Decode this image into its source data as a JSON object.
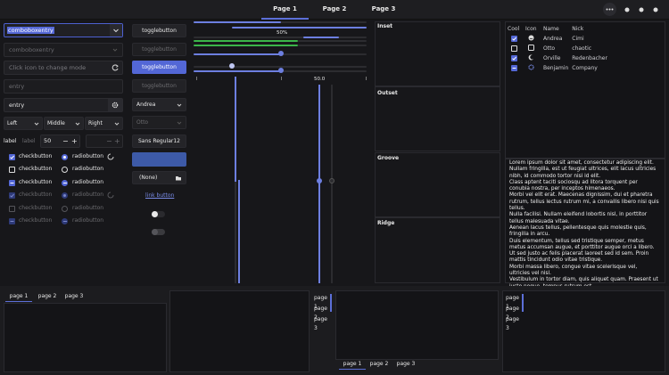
{
  "header": {
    "tabs": [
      "Page 1",
      "Page 2",
      "Page 3"
    ],
    "active_tab": 0
  },
  "left_column": {
    "combo_entry": "comboboxentry",
    "combo_entry_dim": "comboboxentry",
    "icon_entry_placeholder": "Click icon to change mode",
    "entry_placeholder": "entry",
    "entry_value": "entry",
    "align_buttons": [
      "Left",
      "Middle",
      "Right"
    ],
    "spin_label": "label",
    "spin_label_dim": "label",
    "spin_value": "50",
    "spin_minus": "−",
    "spin_plus": "+",
    "checks": [
      {
        "label": "checkbutton",
        "state": "checked",
        "dim": false
      },
      {
        "label": "checkbutton",
        "state": "unchecked",
        "dim": false
      },
      {
        "label": "checkbutton",
        "state": "mixed",
        "dim": false
      },
      {
        "label": "checkbutton",
        "state": "checked",
        "dim": true
      },
      {
        "label": "checkbutton",
        "state": "unchecked",
        "dim": true
      },
      {
        "label": "checkbutton",
        "state": "mixed",
        "dim": true
      }
    ],
    "radios": [
      {
        "label": "radiobutton",
        "state": "checked",
        "dim": false
      },
      {
        "label": "radiobutton",
        "state": "unchecked",
        "dim": false
      },
      {
        "label": "radiobutton",
        "state": "mixed",
        "dim": false
      },
      {
        "label": "radiobutton",
        "state": "checked",
        "dim": true
      },
      {
        "label": "radiobutton",
        "state": "unchecked",
        "dim": true
      },
      {
        "label": "radiobutton",
        "state": "mixed",
        "dim": true
      }
    ]
  },
  "middle_column": {
    "toggle_buttons": [
      "togglebutton",
      "togglebutton",
      "togglebutton",
      "togglebutton"
    ],
    "combo": "Andrea",
    "combo_dim": "Otto",
    "font_button": {
      "name": "Sans Regular",
      "size": "12"
    },
    "file_button": "(None)",
    "link_button": "link button"
  },
  "sliders": {
    "progress_label": "50%",
    "scale_label": "50.0"
  },
  "frames": [
    "Inset",
    "Outset",
    "Groove",
    "Ridge"
  ],
  "tree": {
    "columns": [
      "Cool",
      "Icon",
      "Name",
      "Nick"
    ],
    "rows": [
      {
        "cool": "checked",
        "icon": "smile-icon",
        "name": "Andrea",
        "nick": "Cimi"
      },
      {
        "cool": "unchecked",
        "icon": "sad-icon",
        "name": "Otto",
        "nick": "chaotic"
      },
      {
        "cool": "checked",
        "icon": "moon-icon",
        "name": "Orville",
        "nick": "Redenbacher"
      },
      {
        "cool": "mixed",
        "icon": "gear-icon",
        "name": "Benjamin",
        "nick": "Company"
      }
    ]
  },
  "text_view": [
    "Lorem ipsum dolor sit amet, consectetur adipiscing elit.",
    "Nullam fringilla, est ut feugiat ultrices, elit lacus ultricies nibh, id commodo tortor nisi id elit.",
    "Class aptent taciti sociosqu ad litora torquent per conubia nostra, per inceptos himenaeos.",
    "Morbi vel elit erat. Maecenas dignissim, dui et pharetra rutrum, tellus lectus rutrum mi, a convallis libero nisi quis tellus.",
    "Nulla facilisi. Nullam eleifend lobortis nisl, in porttitor tellus malesuada vitae.",
    "Aenean lacus tellus, pellentesque quis molestie quis, fringilla in arcu.",
    "Duis elementum, tellus sed tristique semper, metus metus accumsan augue, et porttitor augue orci a libero.",
    "Ut sed justo ac felis placerat laoreet sed id sem. Proin mattis tincidunt odio vitae tristique.",
    "Morbi massa libero, congue vitae scelerisque vel, ultricies vel nisl.",
    "Vestibulum in tortor diam, quis aliquet quam. Praesent ut justo neque, tempus rutrum est."
  ],
  "notebooks": {
    "tabs": [
      "page 1",
      "page 2",
      "page 3"
    ]
  },
  "colors": {
    "accent": "#5367d6",
    "background": "#17171a",
    "progress_green": "#3bb54a"
  }
}
